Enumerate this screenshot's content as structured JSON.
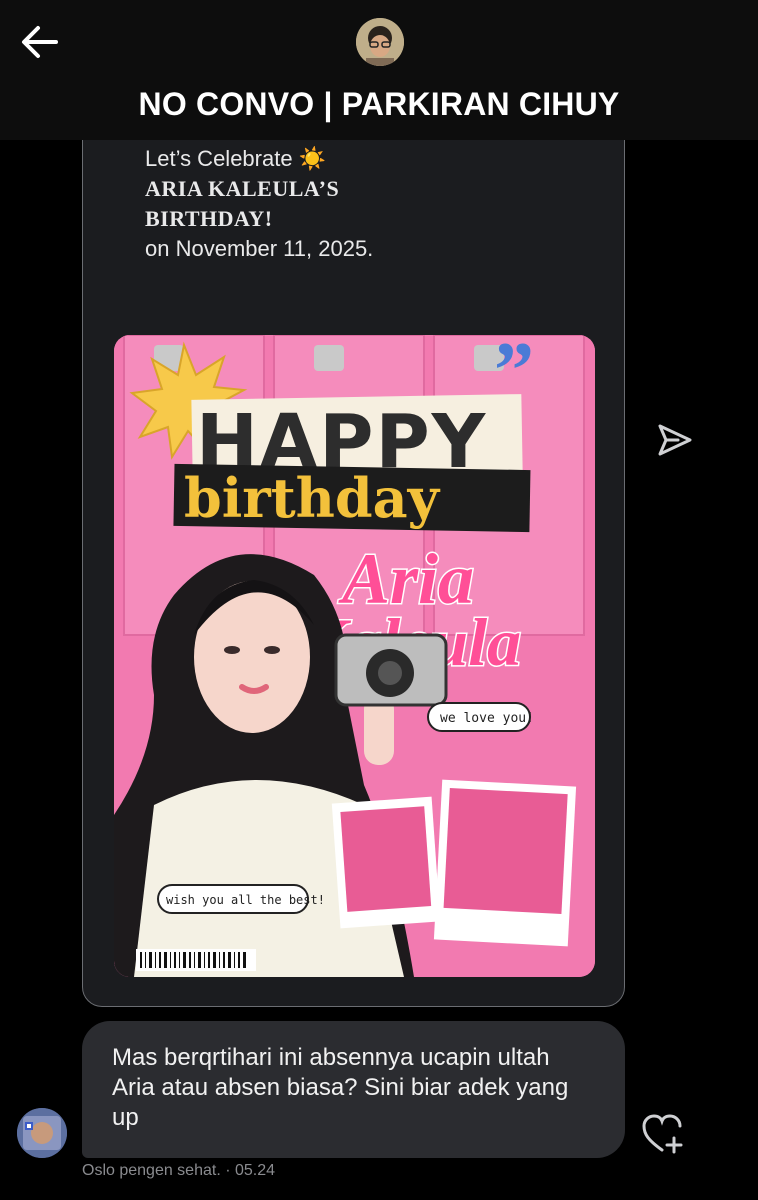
{
  "header": {
    "title": "NO CONVO | PARKIRAN CIHUY",
    "back_icon": "arrow-left-icon",
    "avatar": "profile-avatar"
  },
  "card": {
    "line1": "Let’s Celebrate ☀️",
    "line2": "ARIA KALEULA’S",
    "line3": "BIRTHDAY!",
    "line4": "on November 11, 2025.",
    "poster": {
      "word_happy": "HAPPY",
      "word_birthday": "birthday",
      "name_first": "Aria",
      "name_last": "Kaleula",
      "sticker1": "we love you!",
      "sticker2": "wish you all the best!"
    }
  },
  "message": {
    "text": "Mas berqrtihari ini absennya ucapin ultah Aria atau absen biasa? Sini biar adek yang up",
    "meta": "Oslo pengen sehat. · 05.24"
  },
  "icons": {
    "send": "send-icon",
    "react": "heart-plus-icon"
  },
  "colors": {
    "background": "#000000",
    "bubble": "#2b2c30",
    "poster_pink": "#f27ab0"
  }
}
